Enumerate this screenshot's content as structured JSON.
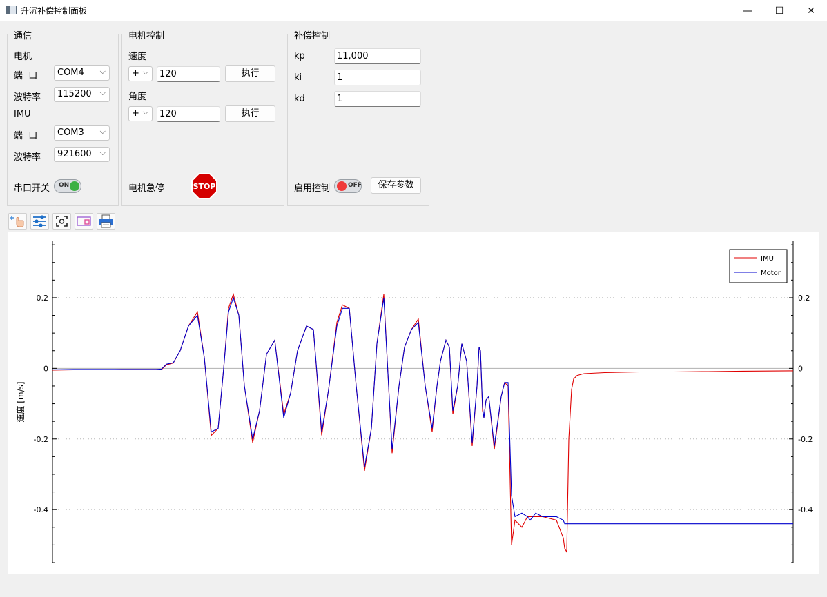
{
  "window": {
    "title": "升沉补偿控制面板",
    "minimize_glyph": "—",
    "maximize_glyph": "☐",
    "close_glyph": "✕"
  },
  "comm": {
    "title": "通信",
    "motor_label": "电机",
    "motor_port_label": "端  口",
    "motor_port": "COM4",
    "motor_baud_label": "波特率",
    "motor_baud": "115200",
    "imu_label": "IMU",
    "imu_port_label": "端  口",
    "imu_port": "COM3",
    "imu_baud_label": "波特率",
    "imu_baud": "921600",
    "serial_switch_label": "串口开关",
    "serial_switch_text": "ON"
  },
  "motor": {
    "title": "电机控制",
    "speed_label": "速度",
    "speed_sign": "+",
    "speed_value": "120",
    "speed_exec": "执行",
    "angle_label": "角度",
    "angle_sign": "+",
    "angle_value": "120",
    "angle_exec": "执行",
    "estop_label": "电机急停",
    "stop_text": "STOP"
  },
  "comp": {
    "title": "补偿控制",
    "kp_label": "kp",
    "kp_value": "11,000",
    "ki_label": "ki",
    "ki_value": "1",
    "kd_label": "kd",
    "kd_value": "1",
    "enable_label": "启用控制",
    "enable_text": "OFF",
    "save_label": "保存参数"
  },
  "toolbar": {
    "icons": [
      "pointer-move-icon",
      "sliders-icon",
      "zoom-fit-icon",
      "layout-icon",
      "print-icon"
    ]
  },
  "colors": {
    "imu": "#e00000",
    "motor": "#0000cc",
    "toggle_on": "#3cb043",
    "toggle_off": "#f03a3a",
    "stop": "#d50000"
  },
  "chart_data": {
    "type": "line",
    "ylabel": "速度 [m/s]",
    "ylim": [
      -0.55,
      0.36
    ],
    "yticks": [
      0.2,
      0,
      -0.2,
      -0.4
    ],
    "ytick_labels": [
      "0.2",
      "0",
      "-0.2",
      "-0.4"
    ],
    "grid": "horizontal dotted",
    "legend": "top-right",
    "series": [
      {
        "name": "IMU",
        "color": "#e00000",
        "x": [
          0,
          30,
          60,
          100,
          130,
          150,
          158,
          165,
          175,
          185,
          197,
          210,
          220,
          230,
          240,
          248,
          255,
          262,
          270,
          278,
          290,
          300,
          310,
          322,
          335,
          345,
          355,
          368,
          378,
          390,
          400,
          412,
          420,
          430,
          440,
          452,
          462,
          470,
          480,
          492,
          502,
          510,
          520,
          530,
          540,
          550,
          557,
          562,
          570,
          575,
          580,
          587,
          593,
          600,
          608,
          615,
          618,
          620,
          623,
          625,
          628,
          632,
          640,
          650,
          655,
          660,
          665,
          670,
          680,
          688,
          692,
          700,
          710,
          730,
          740,
          742,
          745,
          748,
          752,
          755,
          760,
          770,
          800,
          850,
          900,
          950,
          1000,
          1073
        ],
        "y": [
          -0.005,
          -0.004,
          -0.004,
          -0.003,
          -0.003,
          -0.003,
          -0.003,
          0.01,
          0.015,
          0.05,
          0.12,
          0.16,
          0.03,
          -0.19,
          -0.17,
          0.0,
          0.17,
          0.21,
          0.15,
          -0.05,
          -0.21,
          -0.12,
          0.04,
          0.08,
          -0.13,
          -0.07,
          0.05,
          0.12,
          0.11,
          -0.19,
          -0.06,
          0.13,
          0.18,
          0.17,
          -0.05,
          -0.29,
          -0.17,
          0.07,
          0.21,
          -0.24,
          -0.05,
          0.06,
          0.11,
          0.14,
          -0.05,
          -0.18,
          -0.05,
          0.02,
          0.08,
          0.06,
          -0.13,
          -0.05,
          0.07,
          0.02,
          -0.22,
          -0.05,
          0.06,
          0.05,
          -0.12,
          -0.14,
          -0.09,
          -0.08,
          -0.23,
          -0.08,
          -0.04,
          -0.05,
          -0.5,
          -0.43,
          -0.45,
          -0.42,
          -0.42,
          -0.42,
          -0.42,
          -0.43,
          -0.48,
          -0.51,
          -0.52,
          -0.2,
          -0.06,
          -0.03,
          -0.02,
          -0.015,
          -0.012,
          -0.01,
          -0.01,
          -0.009,
          -0.008,
          -0.007
        ]
      },
      {
        "name": "Motor",
        "color": "#0000cc",
        "x": [
          0,
          30,
          60,
          100,
          130,
          150,
          158,
          165,
          175,
          185,
          197,
          210,
          220,
          230,
          240,
          248,
          255,
          262,
          270,
          278,
          290,
          300,
          310,
          322,
          335,
          345,
          355,
          368,
          378,
          390,
          400,
          412,
          420,
          430,
          440,
          452,
          462,
          470,
          480,
          492,
          502,
          510,
          520,
          530,
          540,
          550,
          557,
          562,
          570,
          575,
          580,
          587,
          593,
          600,
          608,
          615,
          618,
          620,
          623,
          625,
          628,
          632,
          640,
          650,
          655,
          660,
          665,
          670,
          680,
          688,
          692,
          700,
          710,
          730,
          740,
          742,
          745,
          748,
          752,
          755,
          760,
          770,
          800,
          850,
          900,
          950,
          1000,
          1073
        ],
        "y": [
          -0.004,
          -0.003,
          -0.003,
          -0.003,
          -0.003,
          -0.003,
          -0.002,
          0.012,
          0.016,
          0.05,
          0.12,
          0.15,
          0.03,
          -0.18,
          -0.17,
          0.0,
          0.16,
          0.2,
          0.15,
          -0.05,
          -0.2,
          -0.12,
          0.04,
          0.08,
          -0.14,
          -0.07,
          0.05,
          0.12,
          0.11,
          -0.18,
          -0.06,
          0.12,
          0.17,
          0.17,
          -0.05,
          -0.28,
          -0.17,
          0.07,
          0.2,
          -0.23,
          -0.05,
          0.06,
          0.11,
          0.13,
          -0.05,
          -0.17,
          -0.05,
          0.02,
          0.08,
          0.06,
          -0.12,
          -0.05,
          0.07,
          0.02,
          -0.21,
          -0.05,
          0.06,
          0.05,
          -0.11,
          -0.14,
          -0.09,
          -0.08,
          -0.22,
          -0.08,
          -0.04,
          -0.04,
          -0.36,
          -0.42,
          -0.41,
          -0.42,
          -0.43,
          -0.41,
          -0.42,
          -0.42,
          -0.43,
          -0.44,
          -0.44,
          -0.44,
          -0.44,
          -0.44,
          -0.44,
          -0.44,
          -0.44,
          -0.44,
          -0.44,
          -0.44,
          -0.44,
          -0.44
        ]
      }
    ]
  }
}
